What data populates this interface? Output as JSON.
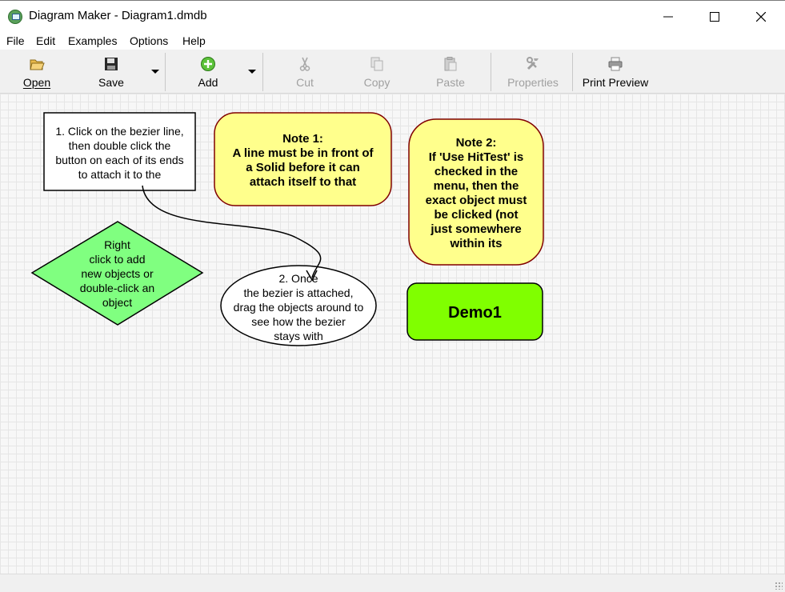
{
  "window": {
    "title": "Diagram Maker - Diagram1.dmdb",
    "minimize": "—",
    "maximize": "☐",
    "close": "✕"
  },
  "menu": [
    "File",
    "Edit",
    "Examples",
    "Options",
    "Help"
  ],
  "toolbar": {
    "open": "Open",
    "save": "Save",
    "add": "Add",
    "cut": "Cut",
    "copy": "Copy",
    "paste": "Paste",
    "properties": "Properties",
    "print_preview": "Print Preview"
  },
  "diagram": {
    "box1": [
      "1. Click on the bezier line,",
      "then double click the",
      "button on each of its ends",
      "to attach it to the"
    ],
    "note1": [
      "Note 1:",
      "A line must be in front of",
      "a Solid before it can",
      "attach itself to that"
    ],
    "note2": [
      "Note 2:",
      "If 'Use HitTest' is",
      "checked in the",
      "menu, then the",
      "exact object must",
      "be clicked (not",
      "just somewhere",
      "within its"
    ],
    "diamond": [
      "Right",
      "click to add",
      "new objects or",
      "double-click an",
      "object"
    ],
    "ellipse": [
      "2. Once",
      "the bezier is attached,",
      "drag the objects around to",
      "see how the bezier",
      "stays with"
    ],
    "demo": "Demo1",
    "colors": {
      "note_fill": "#ffff8c",
      "note_border": "#800000",
      "diamond_fill": "#80ff80",
      "demo_fill": "#80ff00"
    }
  }
}
